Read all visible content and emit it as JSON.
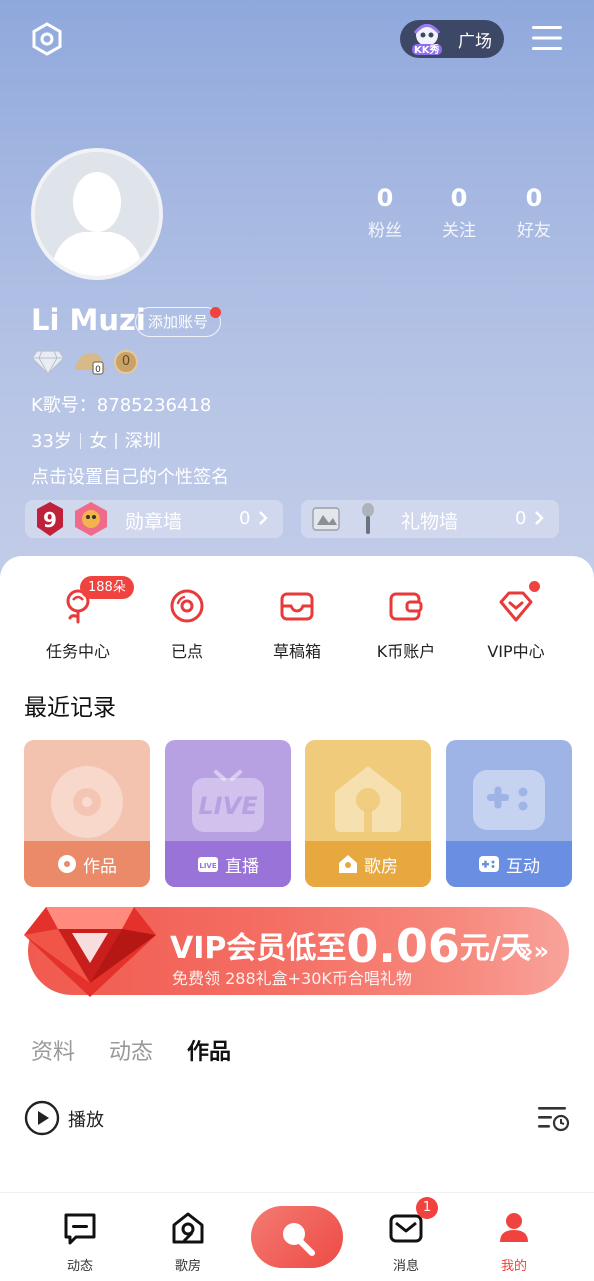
{
  "topbar": {
    "kk_badge_text": "KK秀",
    "square_label": "广场"
  },
  "profile": {
    "username": "Li Muzi",
    "add_account_label": "添加账号",
    "k_id_line": "K歌号：8785236418",
    "age": "33岁",
    "gender": "女",
    "city": "深圳",
    "signature": "点击设置自己的个性签名",
    "level_badge": "0"
  },
  "stats": [
    {
      "value": "0",
      "label": "粉丝"
    },
    {
      "value": "0",
      "label": "关注"
    },
    {
      "value": "0",
      "label": "好友"
    }
  ],
  "walls": {
    "medal": {
      "label": "勋章墙",
      "count": "0"
    },
    "gift": {
      "label": "礼物墙",
      "count": "0"
    }
  },
  "quick_actions": [
    {
      "label": "任务中心",
      "badge": "188朵"
    },
    {
      "label": "已点"
    },
    {
      "label": "草稿箱"
    },
    {
      "label": "K币账户"
    },
    {
      "label": "VIP中心"
    }
  ],
  "recent": {
    "title": "最近记录",
    "tiles": [
      {
        "label": "作品",
        "bg": "#f3c3b0",
        "band": "#ea8a69"
      },
      {
        "label": "直播",
        "bg": "#b8a1e3",
        "band": "#9a73d9",
        "big_text": "LIVE"
      },
      {
        "label": "歌房",
        "bg": "#f0cb7c",
        "band": "#e7a83f"
      },
      {
        "label": "互动",
        "bg": "#9fb4e6",
        "band": "#6a8fe2"
      }
    ]
  },
  "vip_banner": {
    "main_prefix": "VIP会员低至",
    "price": "0.06",
    "main_suffix": "元/天",
    "sub": "免费领 288礼盒+30K币合唱礼物",
    "arrow": "»»"
  },
  "content_tabs": [
    {
      "label": "资料"
    },
    {
      "label": "动态"
    },
    {
      "label": "作品",
      "active": true
    }
  ],
  "play": {
    "label": "播放"
  },
  "bottom_nav": [
    {
      "label": "动态"
    },
    {
      "label": "歌房"
    },
    {
      "label": "消息",
      "badge": "1"
    },
    {
      "label": "我的",
      "active": true
    }
  ],
  "colors": {
    "accent": "#f0433f",
    "header_top": "#8fa8dc",
    "header_bottom": "#c3cde9"
  }
}
